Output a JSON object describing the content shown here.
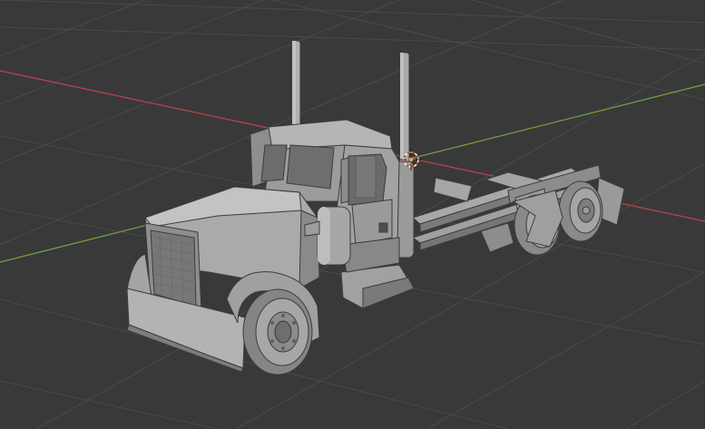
{
  "viewport": {
    "background_color": "#393939",
    "grid_color": "#4a4a4a",
    "x_axis_color": "#c2414f",
    "y_axis_color": "#74a63b",
    "mesh_base_color": "#9a9a9a",
    "mesh_light_color": "#b9b9b9",
    "mesh_shadow_color": "#6a6a6a",
    "mesh_dark_color": "#505050",
    "outline_color": "#3c3c3c",
    "cursor_color": "#e0402e",
    "icons": [
      "3d-cursor-icon"
    ],
    "scene_object": "semi-truck-mesh"
  }
}
